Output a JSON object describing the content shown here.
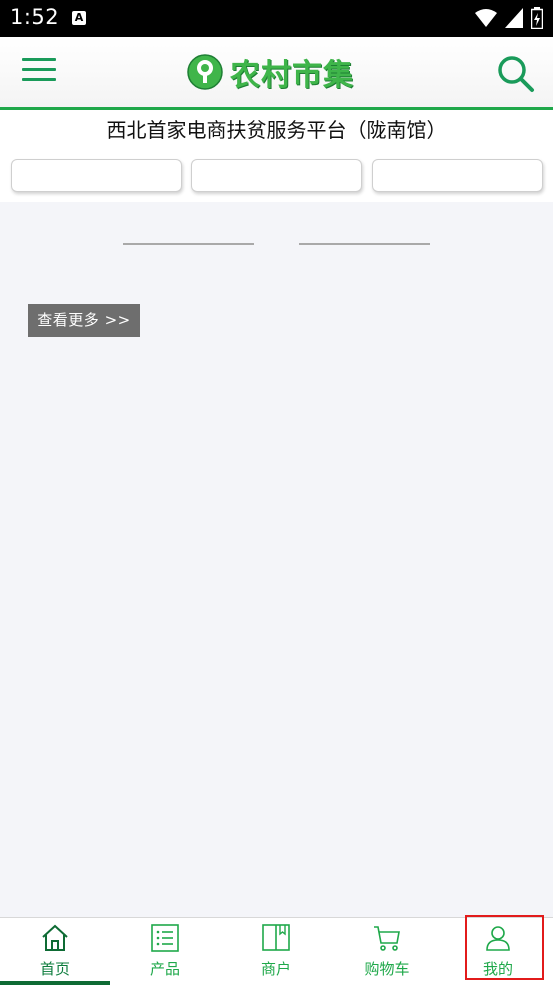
{
  "status_bar": {
    "time": "1:52",
    "notification_badge": "A"
  },
  "header": {
    "menu_icon": "menu-icon",
    "logo_text": "农村市集",
    "search_icon": "search-icon"
  },
  "subtitle": "西北首家电商扶贫服务平台（陇南馆）",
  "more_button": "查看更多 >>",
  "tabs": [
    {
      "label": "首页",
      "icon": "home-icon",
      "active": true
    },
    {
      "label": "产品",
      "icon": "list-icon",
      "active": false
    },
    {
      "label": "商户",
      "icon": "book-icon",
      "active": false
    },
    {
      "label": "购物车",
      "icon": "cart-icon",
      "active": false
    },
    {
      "label": "我的",
      "icon": "user-icon",
      "active": false
    }
  ],
  "colors": {
    "brand_green": "#1fa84a",
    "dark_green": "#0e6b34",
    "highlight_red": "#e21b1b"
  }
}
